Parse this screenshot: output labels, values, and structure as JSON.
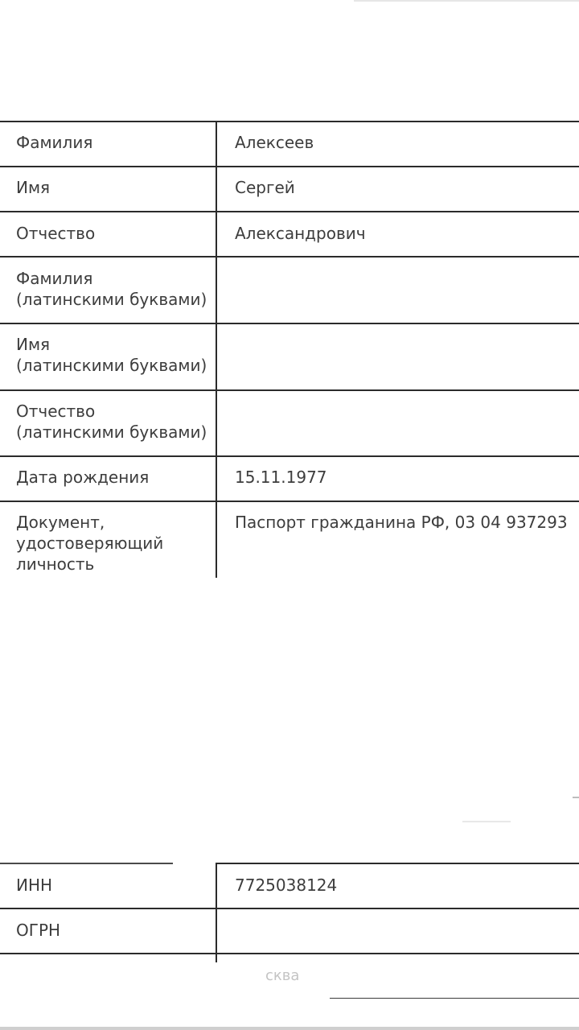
{
  "personal_table": {
    "rows": [
      {
        "label": "Фамилия",
        "value": "Алексеев"
      },
      {
        "label": "Имя",
        "value": "Сергей"
      },
      {
        "label": "Отчество",
        "value": "Александрович"
      },
      {
        "label": "Фамилия\n(латинскими буквами)",
        "value": ""
      },
      {
        "label": "Имя\n(латинскими буквами)",
        "value": ""
      },
      {
        "label": "Отчество\n(латинскими буквами)",
        "value": ""
      },
      {
        "label": "Дата рождения",
        "value": "15.11.1977"
      },
      {
        "label": "Документ,\nудостоверяющий\nличность",
        "value": "Паспорт гражданина РФ, 03 04 937293"
      }
    ]
  },
  "company_table": {
    "rows": [
      {
        "label": "ИНН",
        "value": "7725038124"
      },
      {
        "label": "ОГРН",
        "value": ""
      }
    ]
  },
  "bottom": {
    "partial_city": "сква"
  }
}
